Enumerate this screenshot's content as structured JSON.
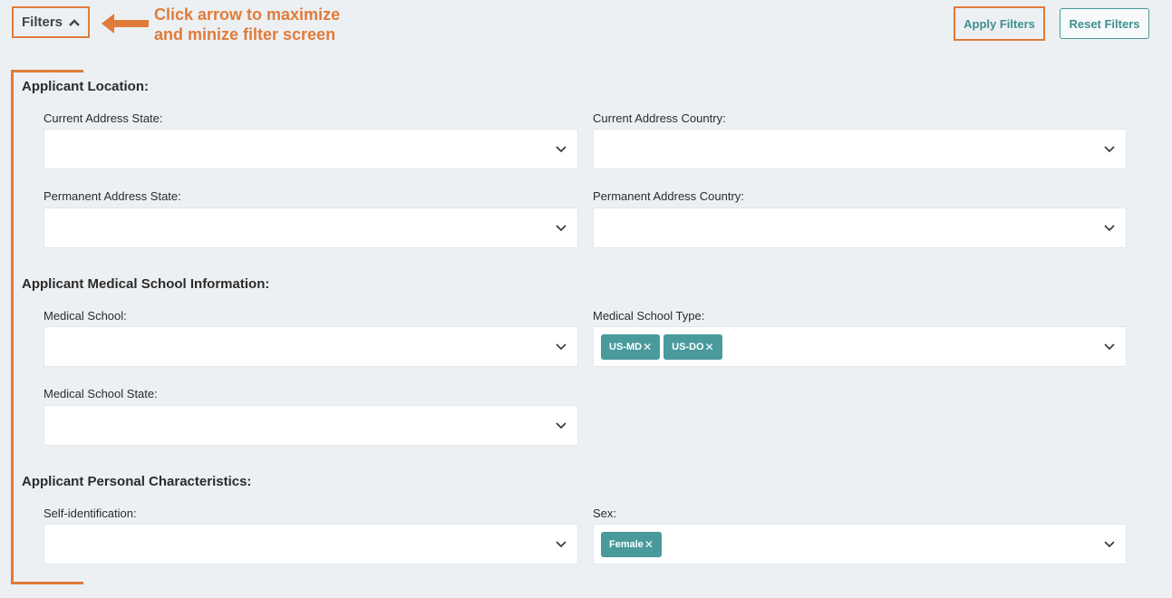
{
  "header": {
    "filters_label": "Filters",
    "annotation": "Click arrow to maximize and minize filter screen",
    "apply_label": "Apply Filters",
    "reset_label": "Reset Filters"
  },
  "sections": {
    "location": {
      "title": "Applicant Location:",
      "current_state_label": "Current Address State:",
      "current_country_label": "Current Address Country:",
      "permanent_state_label": "Permanent Address State:",
      "permanent_country_label": "Permanent Address Country:"
    },
    "medical": {
      "title": "Applicant Medical School Information:",
      "school_label": "Medical School:",
      "type_label": "Medical School Type:",
      "type_selected": [
        "US-MD",
        "US-DO"
      ],
      "state_label": "Medical School State:"
    },
    "personal": {
      "title": "Applicant Personal Characteristics:",
      "self_id_label": "Self-identification:",
      "sex_label": "Sex:",
      "sex_selected": [
        "Female"
      ]
    }
  },
  "colors": {
    "annotation": "#e07b39",
    "accent": "#4a9a9c",
    "background": "#edf0f3"
  },
  "icons": {
    "toggle": "chevron-up-icon",
    "select": "chevron-down-icon",
    "chip_remove": "close-icon"
  }
}
